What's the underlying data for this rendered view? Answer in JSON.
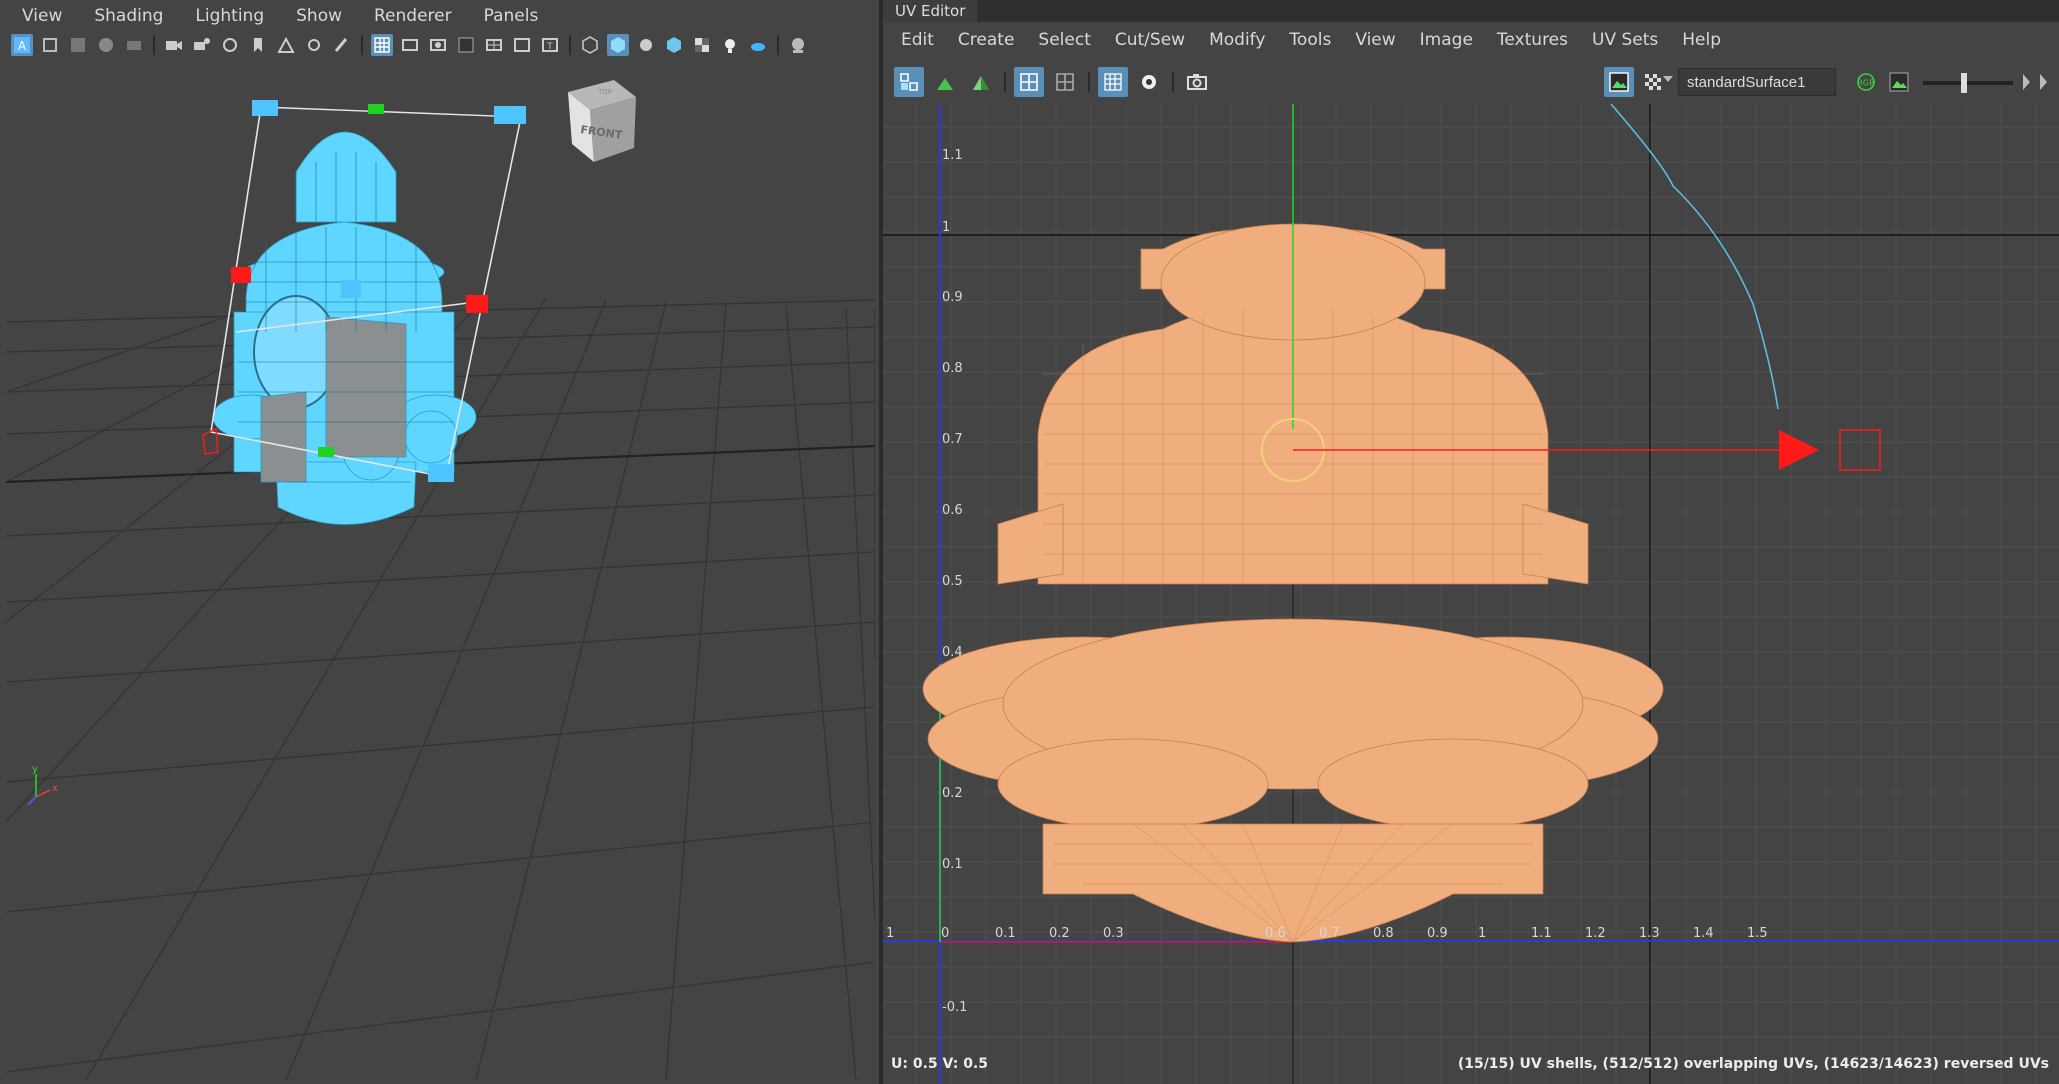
{
  "viewport": {
    "menu": [
      "View",
      "Shading",
      "Lighting",
      "Show",
      "Renderer",
      "Panels"
    ],
    "view_cube": {
      "front_label": "FRONT",
      "top_label": "TOP"
    },
    "axis_labels": {
      "x": "x",
      "y": "y"
    }
  },
  "uv_editor": {
    "title": "UV Editor",
    "menu": [
      "Edit",
      "Create",
      "Select",
      "Cut/Sew",
      "Modify",
      "Tools",
      "View",
      "Image",
      "Textures",
      "UV Sets",
      "Help"
    ],
    "material": "standardSurface1",
    "rgb_label": "RGB",
    "u_ticks": [
      "1",
      "0",
      "0.1",
      "0.2",
      "0.3",
      "0.6",
      "0.7",
      "0.8",
      "0.9",
      "1",
      "1.1",
      "1.2",
      "1.3",
      "1.4",
      "1.5"
    ],
    "v_ticks": [
      "1.1",
      "1",
      "0.9",
      "0.8",
      "0.7",
      "0.6",
      "0.5",
      "0.4",
      "0.2",
      "0.1",
      "-0.1"
    ],
    "status_left": "U:  0.5 V:  0.5",
    "status_right": "(15/15) UV shells, (512/512) overlapping UVs, (14623/14623) reversed UVs"
  },
  "colors": {
    "selection_blue": "#5fd6ff",
    "uv_shell_fill": "#f0ae7e",
    "manip_red": "#ff1a1a",
    "v_axis_green": "#29d629",
    "u_axis_blue": "#2a3cd8"
  }
}
